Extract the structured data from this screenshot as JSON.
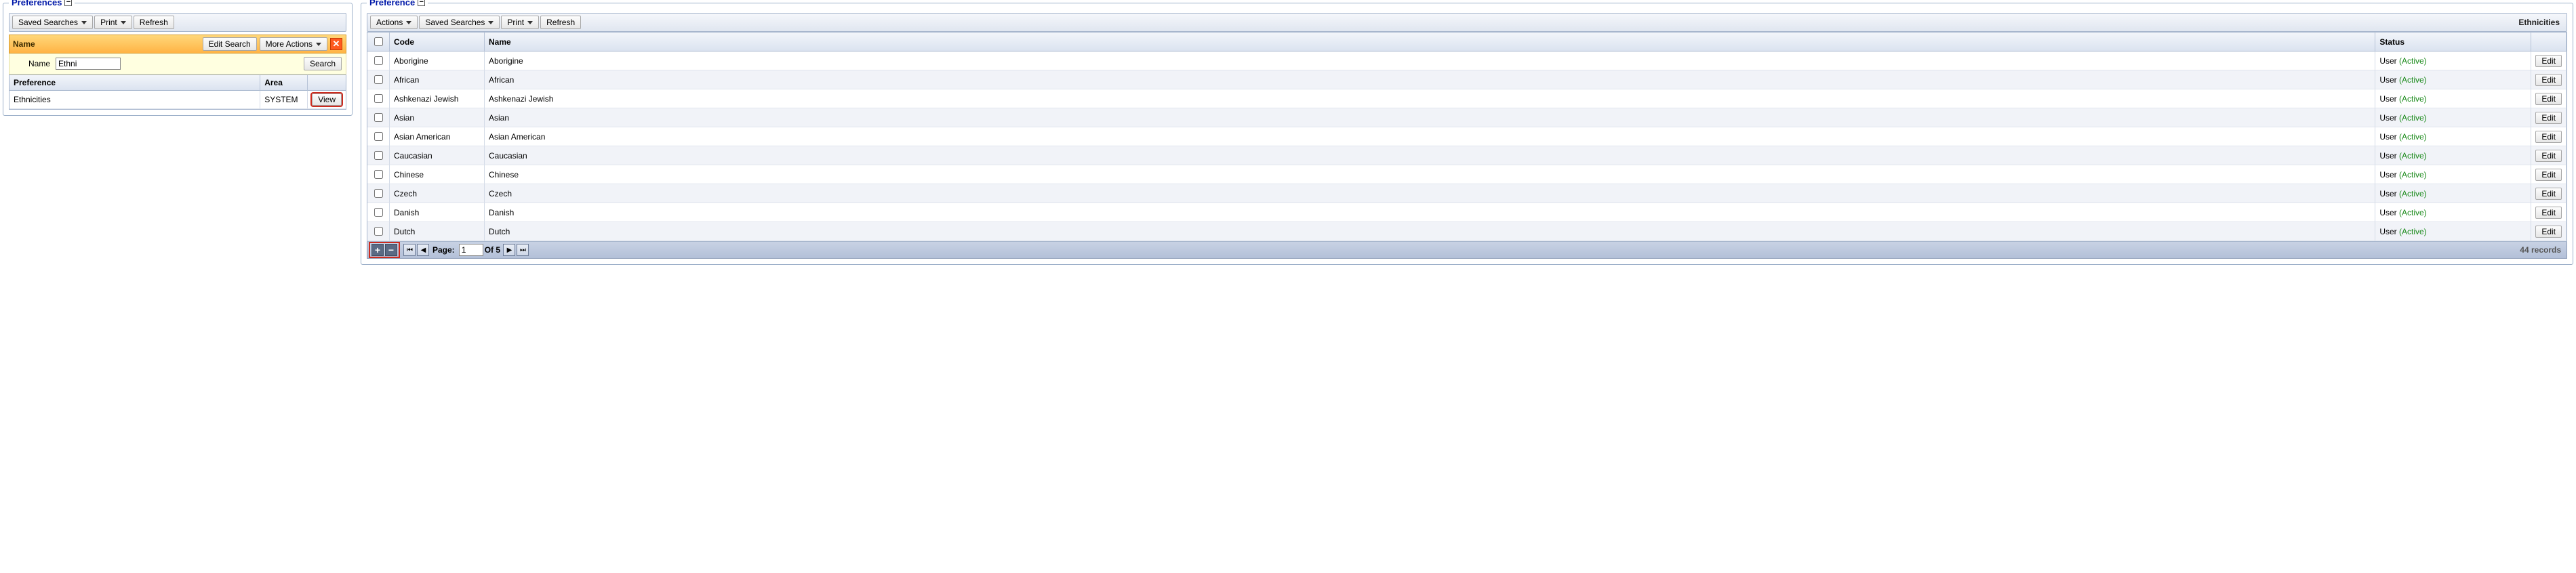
{
  "left": {
    "title": "Preferences",
    "toolbar": {
      "saved_searches": "Saved Searches",
      "print": "Print",
      "refresh": "Refresh"
    },
    "orange": {
      "name_label": "Name",
      "edit_search": "Edit Search",
      "more_actions": "More Actions"
    },
    "search": {
      "name_label": "Name",
      "value": "Ethni",
      "search_btn": "Search"
    },
    "cols": {
      "preference": "Preference",
      "area": "Area"
    },
    "row": {
      "preference": "Ethnicities",
      "area": "SYSTEM",
      "view": "View"
    }
  },
  "right": {
    "title": "Preference",
    "toolbar": {
      "actions": "Actions",
      "saved_searches": "Saved Searches",
      "print": "Print",
      "refresh": "Refresh",
      "heading": "Ethnicities"
    },
    "cols": {
      "code": "Code",
      "name": "Name",
      "status": "Status"
    },
    "status_user": "User",
    "status_active": "(Active)",
    "edit": "Edit",
    "rows": [
      {
        "code": "Aborigine",
        "name": "Aborigine"
      },
      {
        "code": "African",
        "name": "African"
      },
      {
        "code": "Ashkenazi Jewish",
        "name": "Ashkenazi Jewish"
      },
      {
        "code": "Asian",
        "name": "Asian"
      },
      {
        "code": "Asian American",
        "name": "Asian American"
      },
      {
        "code": "Caucasian",
        "name": "Caucasian"
      },
      {
        "code": "Chinese",
        "name": "Chinese"
      },
      {
        "code": "Czech",
        "name": "Czech"
      },
      {
        "code": "Danish",
        "name": "Danish"
      },
      {
        "code": "Dutch",
        "name": "Dutch"
      }
    ],
    "pager": {
      "page_label": "Page:",
      "page": "1",
      "of_label": "Of 5",
      "records": "44 records"
    }
  }
}
